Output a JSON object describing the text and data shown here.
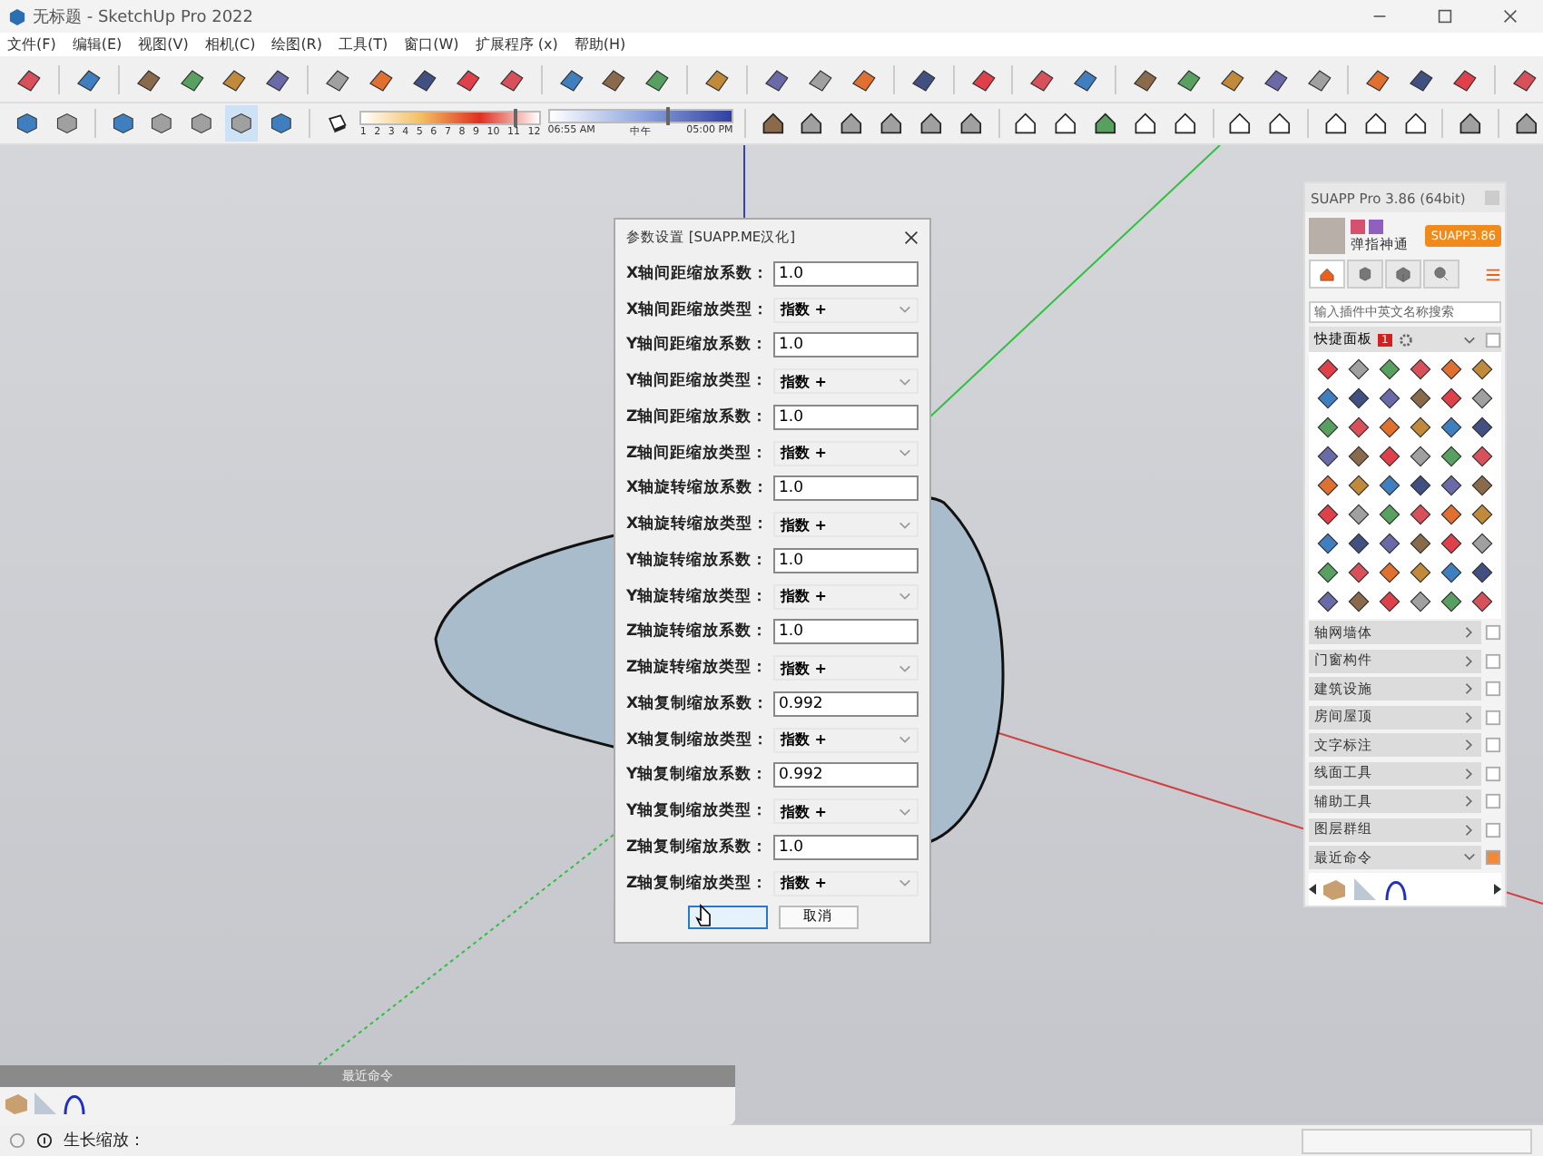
{
  "window": {
    "title": "无标题 - SketchUp Pro 2022"
  },
  "menu": [
    "文件(F)",
    "编辑(E)",
    "视图(V)",
    "相机(C)",
    "绘图(R)",
    "工具(T)",
    "窗口(W)",
    "扩展程序 (x)",
    "帮助(H)"
  ],
  "shadow_bar": {
    "months": [
      "1",
      "2",
      "3",
      "4",
      "5",
      "6",
      "7",
      "8",
      "9",
      "10",
      "11",
      "12"
    ],
    "month_slider": {
      "level": 0.86
    },
    "time_start": "06:55 AM",
    "time_mid": "中午",
    "time_end": "05:00 PM",
    "time_slider": {
      "level": 0.64
    }
  },
  "dialog": {
    "title": "参数设置 [SUAPP.ME汉化]",
    "fields": [
      {
        "label": "X轴间距缩放系数：",
        "kind": "input",
        "value": "1.0"
      },
      {
        "label": "X轴间距缩放类型：",
        "kind": "select",
        "value": "指数 +"
      },
      {
        "label": "Y轴间距缩放系数：",
        "kind": "input",
        "value": "1.0"
      },
      {
        "label": "Y轴间距缩放类型：",
        "kind": "select",
        "value": "指数 +"
      },
      {
        "label": "Z轴间距缩放系数：",
        "kind": "input",
        "value": "1.0"
      },
      {
        "label": "Z轴间距缩放类型：",
        "kind": "select",
        "value": "指数 +"
      },
      {
        "label": "X轴旋转缩放系数：",
        "kind": "input",
        "value": "1.0"
      },
      {
        "label": "X轴旋转缩放类型：",
        "kind": "select",
        "value": "指数 +"
      },
      {
        "label": "Y轴旋转缩放系数：",
        "kind": "input",
        "value": "1.0"
      },
      {
        "label": "Y轴旋转缩放类型：",
        "kind": "select",
        "value": "指数 +"
      },
      {
        "label": "Z轴旋转缩放系数：",
        "kind": "input",
        "value": "1.0"
      },
      {
        "label": "Z轴旋转缩放类型：",
        "kind": "select",
        "value": "指数 +"
      },
      {
        "label": "X轴复制缩放系数：",
        "kind": "input",
        "value": "0.992"
      },
      {
        "label": "X轴复制缩放类型：",
        "kind": "select",
        "value": "指数 +"
      },
      {
        "label": "Y轴复制缩放系数：",
        "kind": "input",
        "value": "0.992"
      },
      {
        "label": "Y轴复制缩放类型：",
        "kind": "select",
        "value": "指数 +"
      },
      {
        "label": "Z轴复制缩放系数：",
        "kind": "input",
        "value": "1.0"
      },
      {
        "label": "Z轴复制缩放类型：",
        "kind": "select",
        "value": "指数 +"
      }
    ],
    "buttons": [
      {
        "focused": true
      },
      {
        "label": "取消",
        "focused": false
      }
    ]
  },
  "suapp_panel": {
    "title": "SUAPP Pro 3.86 (64bit)",
    "user": "弹指神通",
    "version_button": "SUAPP3.86",
    "tabs": [
      {
        "kind": "home",
        "selected": true
      },
      {
        "kind": "box",
        "selected": false
      },
      {
        "kind": "cube",
        "selected": false
      },
      {
        "kind": "search",
        "selected": false
      }
    ],
    "search_placeholder": "输入插件中英文名称搜索",
    "quick_panel": {
      "title": "快捷面板",
      "badge": "1"
    },
    "categories": [
      {
        "label": "轴网墙体",
        "expanded": false
      },
      {
        "label": "门窗构件",
        "expanded": false
      },
      {
        "label": "建筑设施",
        "expanded": false
      },
      {
        "label": "房间屋顶",
        "expanded": false
      },
      {
        "label": "文字标注",
        "expanded": false
      },
      {
        "label": "线面工具",
        "expanded": false
      },
      {
        "label": "辅助工具",
        "expanded": false
      },
      {
        "label": "图层群组",
        "expanded": false
      },
      {
        "label": "最近命令",
        "expanded": true
      }
    ]
  },
  "recent_panel": {
    "title": "最近命令"
  },
  "status_bar": {
    "label": "生长缩放："
  }
}
